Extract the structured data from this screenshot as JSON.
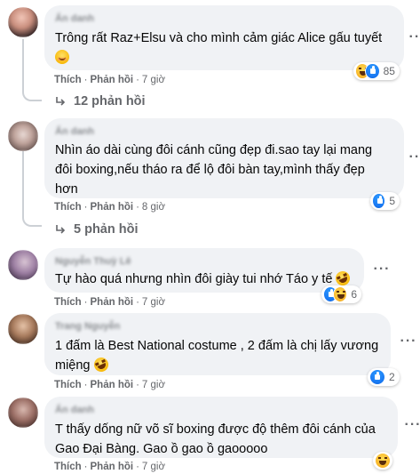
{
  "comments": [
    {
      "author": "Ẩn danh",
      "text": "Trông rất Raz+Elsu và cho mình cảm giác Alice gấu tuyết",
      "reaction_count": "85",
      "like_label": "Thích",
      "reply_label": "Phản hồi",
      "time": "7 giờ",
      "replies_label": "12 phản hồi"
    },
    {
      "author": "Ẩn danh",
      "text": "Nhìn áo dài cùng đôi cánh cũng đẹp đi.sao tay lại mang đôi boxing,nếu tháo ra để lộ đôi bàn tay,mình thấy đẹp hơn",
      "reaction_count": "5",
      "like_label": "Thích",
      "reply_label": "Phản hồi",
      "time": "8 giờ",
      "replies_label": "5 phản hồi"
    },
    {
      "author": "Nguyễn Thuỳ Lê",
      "text": "Tự hào quá nhưng nhìn đôi giày tui nhớ Táo y tế",
      "reaction_count": "6",
      "like_label": "Thích",
      "reply_label": "Phản hồi",
      "time": "7 giờ"
    },
    {
      "author": "Trang Nguyễn",
      "text": "1 đấm là Best National costume , 2 đấm là chị lấy vương miệng",
      "reaction_count": "2",
      "like_label": "Thích",
      "reply_label": "Phản hồi",
      "time": "7 giờ"
    },
    {
      "author": "Ẩn danh",
      "text": "T thấy dống nữ võ sĩ boxing được độ thêm đôi cánh của Gao Đại Bàng. Gao ồ gao ồ gaooooo",
      "reaction_count": "",
      "like_label": "Thích",
      "reply_label": "Phản hồi",
      "time": "7 giờ"
    }
  ],
  "separator": "·",
  "more_glyph": "···",
  "colors": {
    "bubble": "#f0f2f5",
    "secondary_text": "#65676b",
    "like_blue": "#1877f2",
    "haha_yellow": "#f7b125"
  },
  "icons": {
    "like": "like-reaction-icon",
    "haha": "haha-reaction-icon",
    "more": "more-options-icon",
    "reply_arrow": "reply-arrow-icon"
  }
}
